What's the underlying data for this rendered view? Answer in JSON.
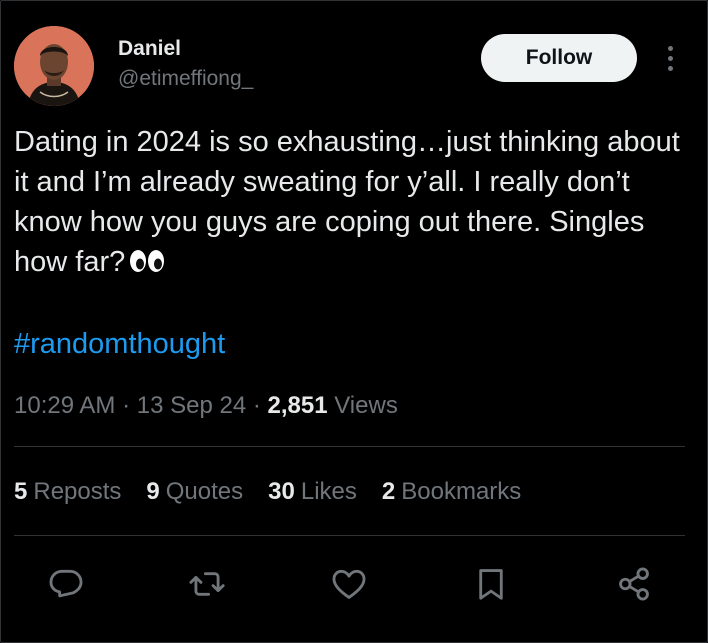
{
  "author": {
    "name": "Daniel",
    "handle": "@etimeffiong_"
  },
  "header": {
    "follow_label": "Follow"
  },
  "tweet": {
    "text": "Dating in 2024 is so exhausting…just thinking about it and I’m already sweating for y’all. I really don’t know how you guys are coping out there. Singles how far?",
    "hashtag": "#randomthought",
    "emoji_icon": "eyes-emoji"
  },
  "meta": {
    "time": "10:29 AM",
    "sep1": " · ",
    "date": "13 Sep 24",
    "sep2": " · ",
    "views_count": "2,851",
    "views_label": " Views"
  },
  "stats": [
    {
      "count": "5",
      "label": "Reposts"
    },
    {
      "count": "9",
      "label": "Quotes"
    },
    {
      "count": "30",
      "label": "Likes"
    },
    {
      "count": "2",
      "label": "Bookmarks"
    }
  ],
  "actions": [
    "reply-icon",
    "repost-icon",
    "like-icon",
    "bookmark-icon",
    "share-icon"
  ],
  "colors": {
    "background": "#000000",
    "text": "#e7e9ea",
    "secondary": "#71767b",
    "link": "#1d9bf0",
    "avatar_bg": "#d9745a"
  }
}
